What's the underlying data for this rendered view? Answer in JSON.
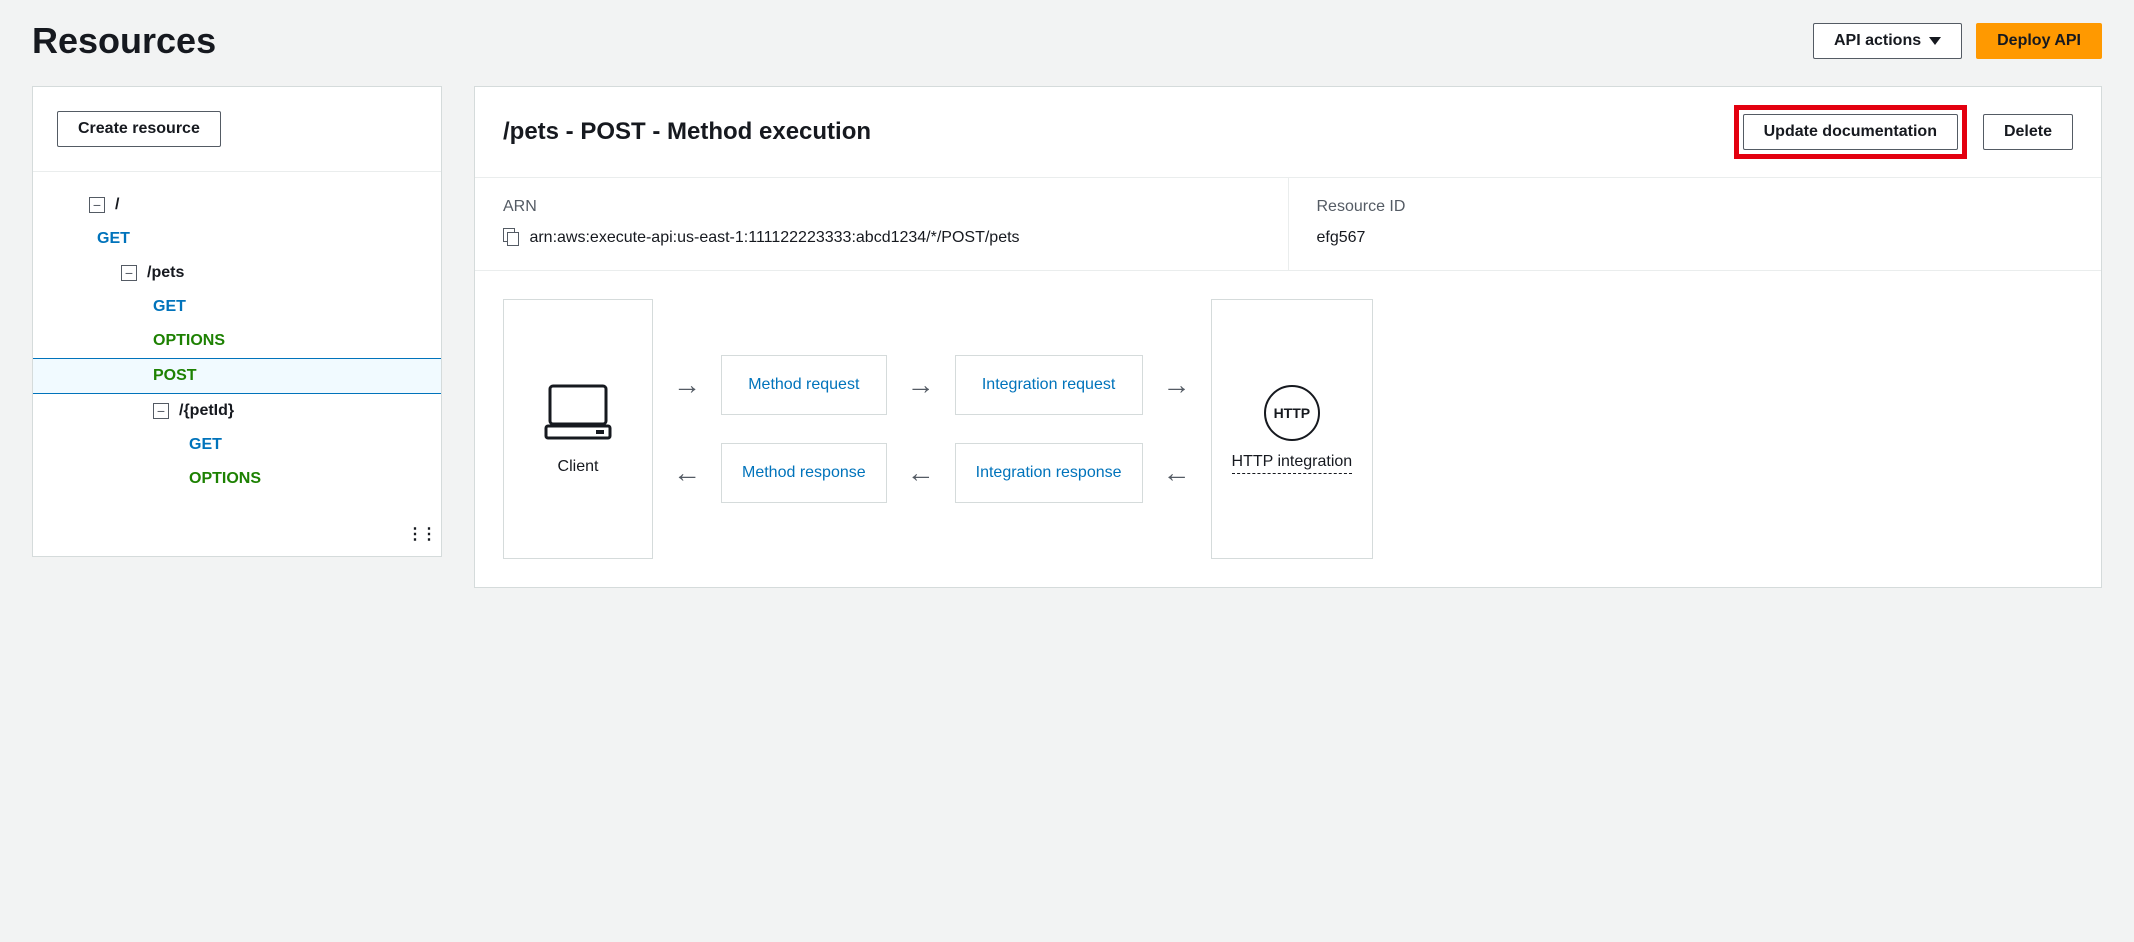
{
  "page": {
    "title": "Resources",
    "api_actions_label": "API actions",
    "deploy_label": "Deploy API"
  },
  "sidebar": {
    "create_label": "Create resource",
    "tree": {
      "root": "/",
      "root_methods": [
        "GET"
      ],
      "pets": {
        "path": "/pets",
        "methods": [
          "GET",
          "OPTIONS",
          "POST"
        ],
        "selected": "POST",
        "petId": {
          "path": "/{petId}",
          "methods": [
            "GET",
            "OPTIONS"
          ]
        }
      }
    }
  },
  "main": {
    "title": "/pets - POST - Method execution",
    "update_doc_label": "Update documentation",
    "delete_label": "Delete",
    "arn_label": "ARN",
    "arn_value": "arn:aws:execute-api:us-east-1:111122223333:abcd1234/*/POST/pets",
    "resource_id_label": "Resource ID",
    "resource_id_value": "efg567",
    "flow": {
      "client": "Client",
      "method_request": "Method request",
      "integration_request": "Integration request",
      "http_badge": "HTTP",
      "http_label": "HTTP integration",
      "method_response": "Method response",
      "integration_response": "Integration response"
    }
  }
}
